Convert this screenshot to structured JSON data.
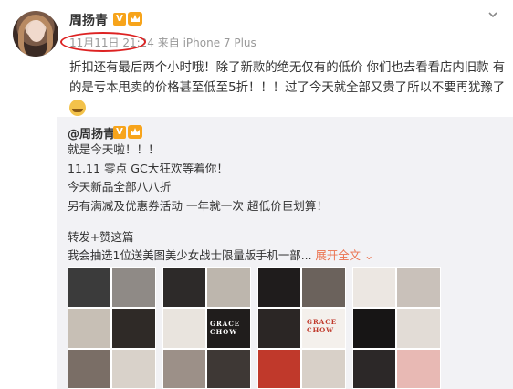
{
  "post": {
    "author": "周扬青",
    "time": "11月11日 21:24",
    "source": "来自 iPhone 7 Plus",
    "text_line1": "折扣还有最后两个小时哦！除了新款的绝无仅有的低价 你们也去看看店内旧款 有",
    "text_line2": "的是亏本甩卖的价格甚至低至5折！！！过了今天就全部又贵了所以不要再犹豫了",
    "emoji": "doge-emoji"
  },
  "repost": {
    "author": "@周扬青",
    "lines": [
      "就是今天啦！！！",
      "11.11 零点 GC大狂欢等着你！",
      "今天新品全部八八折",
      "另有满减及优惠券活动 一年就一次 超低价巨划算！"
    ],
    "forward_label": "转发+赞这篇",
    "promo_text": "我会抽选1位送美图美少女战士限量版手机一部...",
    "expand_label": "展开全文",
    "caption_text": "GRACE CHOW"
  },
  "colors": {
    "accent": "#eb7350",
    "badge": "#f7a41b",
    "highlight": "#dd2222",
    "repost_bg": "#f2f2f5"
  }
}
